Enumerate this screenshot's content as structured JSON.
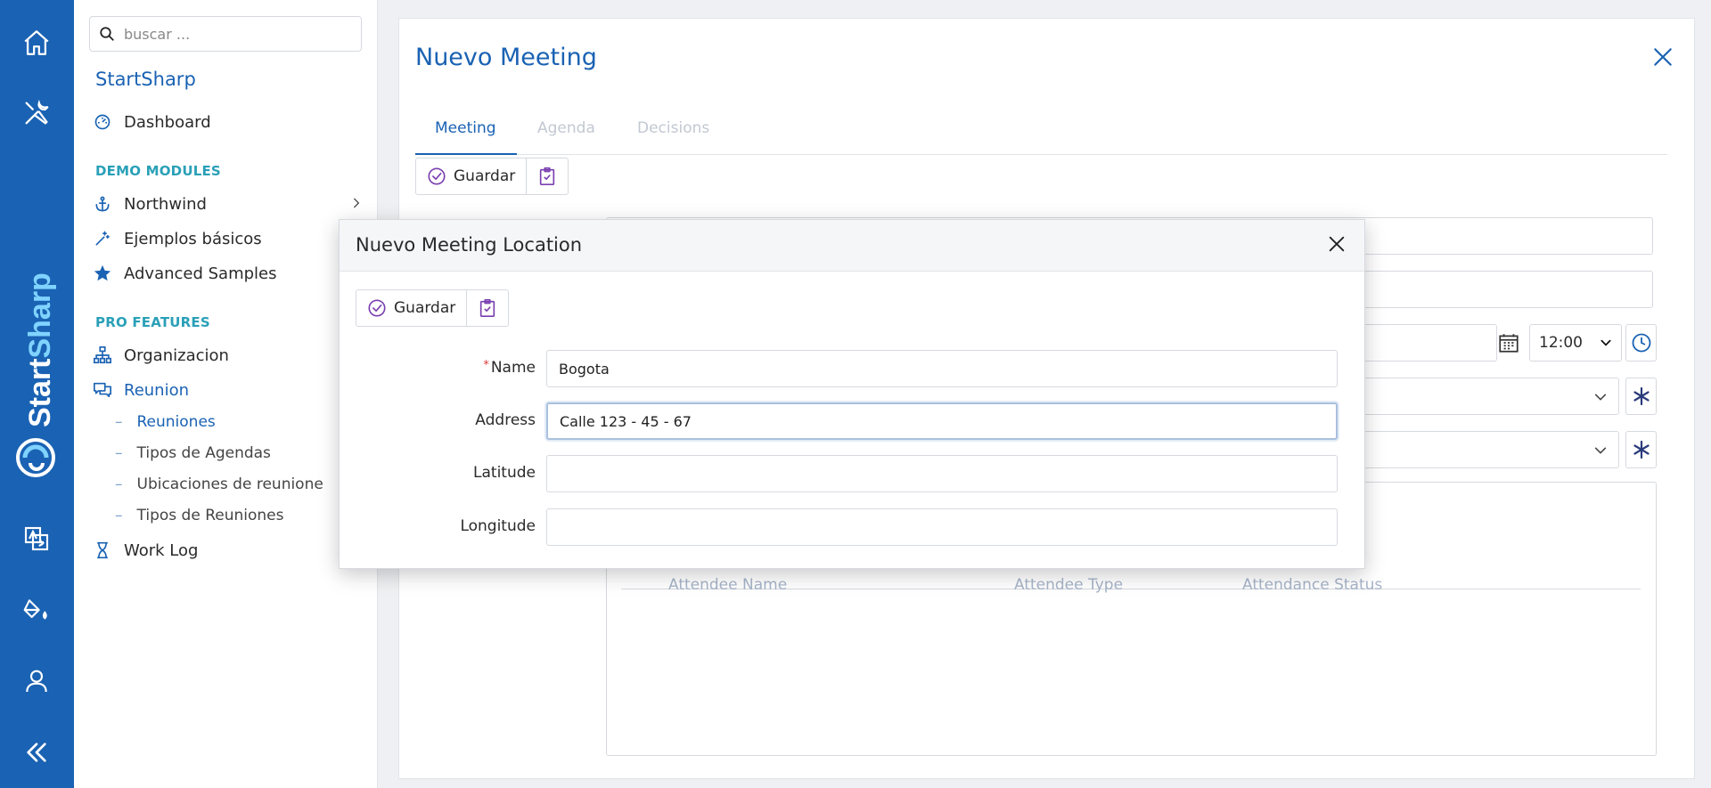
{
  "app": {
    "brand_name": "StartSharp",
    "search_placeholder": "buscar ..."
  },
  "sidebar": {
    "title": "StartSharp",
    "dashboard": "Dashboard",
    "sections": [
      {
        "label": "DEMO MODULES",
        "items": [
          "Northwind",
          "Ejemplos básicos",
          "Advanced Samples"
        ]
      },
      {
        "label": "PRO FEATURES",
        "items": [
          "Organizacion",
          "Reunion"
        ]
      }
    ],
    "reunion_sub": [
      "Reuniones",
      "Tipos de Agendas",
      "Ubicaciones de reunione",
      "Tipos de Reuniones"
    ],
    "work_log": "Work Log"
  },
  "main": {
    "title": "Nuevo Meeting",
    "tabs": [
      "Meeting",
      "Agenda",
      "Decisions"
    ],
    "save_label": "Guardar",
    "time_value": "12:00",
    "grid_columns": [
      "Attendee Name",
      "Attendee Type",
      "Attendance Status"
    ]
  },
  "dialog": {
    "title": "Nuevo Meeting Location",
    "save_label": "Guardar",
    "fields": [
      {
        "label": "Name",
        "value": "Bogota",
        "required": true
      },
      {
        "label": "Address",
        "value": "Calle 123 - 45 - 67",
        "required": false
      },
      {
        "label": "Latitude",
        "value": "",
        "required": false
      },
      {
        "label": "Longitude",
        "value": "",
        "required": false
      }
    ]
  },
  "colors": {
    "primary": "#1a62b3",
    "section_label": "#2aa0b8",
    "save_icon": "#7a3fb0"
  }
}
